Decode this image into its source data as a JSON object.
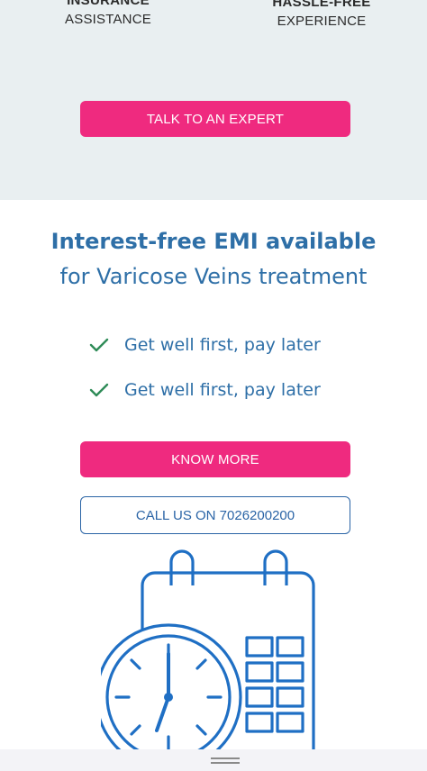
{
  "features": [
    {
      "line1": "INSURANCE",
      "line2": "ASSISTANCE"
    },
    {
      "line1": "HASSLE-FREE",
      "line2": "EXPERIENCE"
    }
  ],
  "cta": {
    "talk_label": "TALK TO AN EXPERT",
    "know_label": "KNOW MORE",
    "call_label": "CALL US ON 7026200200"
  },
  "emi": {
    "title": "Interest-free EMI available",
    "subtitle": "for Varicose Veins treatment"
  },
  "benefits": [
    {
      "label": "Get well first, pay later",
      "icon": "check-icon"
    },
    {
      "label": "Get well first, pay later",
      "icon": "check-icon"
    }
  ],
  "colors": {
    "accent_pink": "#ef2a7f",
    "primary_blue": "#2e6fa7",
    "top_background": "#e9eff1",
    "check_green": "#2e8b57"
  },
  "illustration": {
    "icon": "calendar-clock-icon"
  }
}
